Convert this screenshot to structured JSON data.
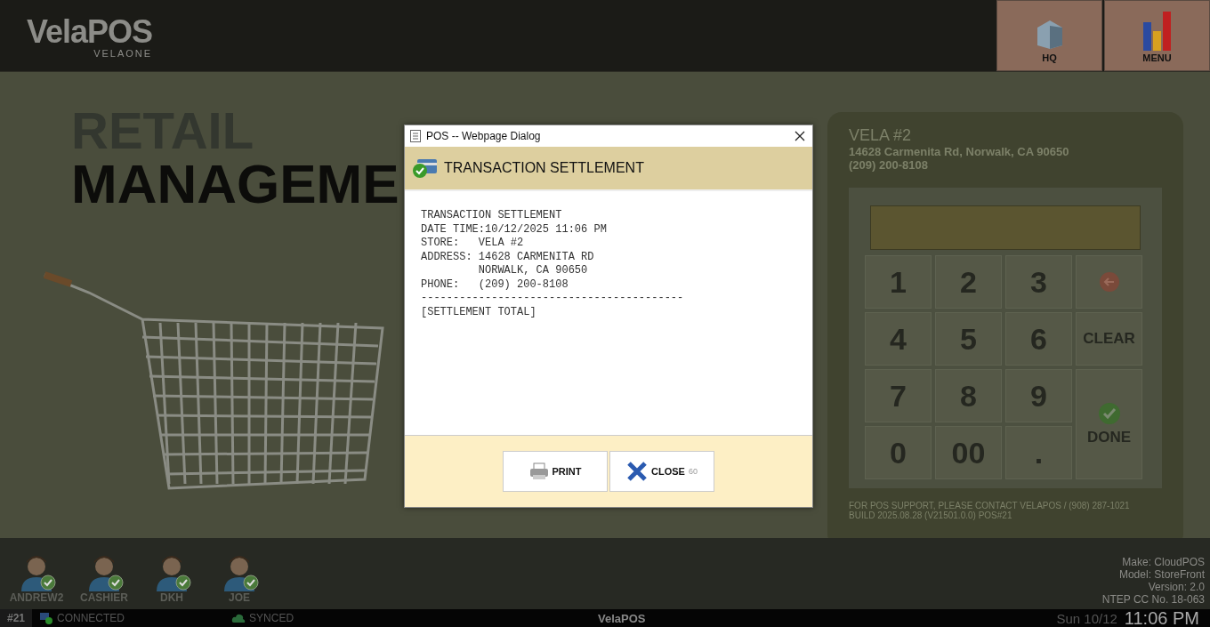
{
  "header": {
    "logo": "VelaPOS",
    "logo_sub": "VELAONE",
    "buttons": [
      {
        "label": "HQ",
        "kind": "hq"
      },
      {
        "label": "MENU",
        "kind": "menu"
      }
    ]
  },
  "hero": {
    "line1": "RETAIL",
    "line2": "MANAGEME"
  },
  "store": {
    "name": "VELA #2",
    "address": "14628 Carmenita Rd, Norwalk, CA 90650",
    "phone": "(209) 200-8108",
    "keys": [
      {
        "label": "1",
        "kind": "digit"
      },
      {
        "label": "2",
        "kind": "digit"
      },
      {
        "label": "3",
        "kind": "digit"
      },
      {
        "kind": "backspace"
      },
      {
        "label": "4",
        "kind": "digit"
      },
      {
        "label": "5",
        "kind": "digit"
      },
      {
        "label": "6",
        "kind": "digit"
      },
      {
        "label": "CLEAR",
        "kind": "clear"
      },
      {
        "label": "7",
        "kind": "digit"
      },
      {
        "label": "8",
        "kind": "digit"
      },
      {
        "label": "9",
        "kind": "digit"
      },
      {
        "label": "DONE",
        "kind": "done"
      },
      {
        "label": "0",
        "kind": "digit"
      },
      {
        "label": "00",
        "kind": "digit"
      },
      {
        "label": ".",
        "kind": "digit"
      }
    ],
    "support": "FOR POS SUPPORT, PLEASE CONTACT VELAPOS / (908) 287-1021",
    "build": "BUILD 2025.08.28 (V21501.0.0) POS#21"
  },
  "users": [
    {
      "name": "ANDREW2",
      "online": true
    },
    {
      "name": "CASHIER",
      "online": true
    },
    {
      "name": "DKH",
      "online": true
    },
    {
      "name": "JOE",
      "online": true
    }
  ],
  "device_info": [
    "Make: CloudPOS",
    "Model: StoreFront",
    "Version: 2.0",
    "NTEP CC No. 18-063"
  ],
  "status_bar": {
    "terminal": "#21",
    "connection": "CONNECTED",
    "sync": "SYNCED",
    "brand": "VelaPOS",
    "date": "Sun 10/12",
    "time": "11:06 PM"
  },
  "dialog": {
    "window_title": "POS -- Webpage Dialog",
    "heading": "TRANSACTION SETTLEMENT",
    "receipt": [
      "TRANSACTION SETTLEMENT",
      "DATE TIME:10/12/2025 11:06 PM",
      "STORE:   VELA #2",
      "ADDRESS: 14628 CARMENITA RD",
      "         NORWALK, CA 90650",
      "PHONE:   (209) 200-8108",
      "-----------------------------------------",
      "[SETTLEMENT TOTAL]"
    ],
    "buttons": [
      {
        "label": "PRINT",
        "kind": "print"
      },
      {
        "label": "CLOSE",
        "kind": "close",
        "countdown": "60"
      }
    ]
  }
}
